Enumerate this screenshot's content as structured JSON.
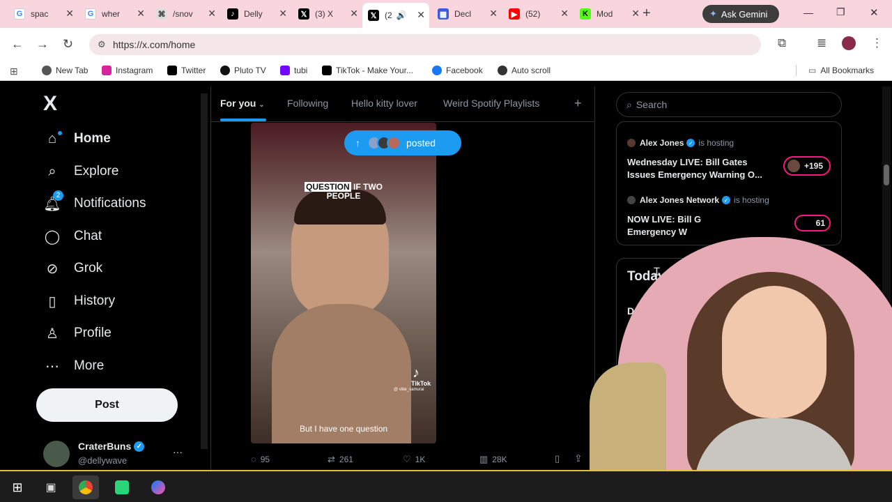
{
  "browser": {
    "tabs": [
      {
        "label": "spac",
        "icon": "google-icon",
        "color": "#4285f4"
      },
      {
        "label": "wher",
        "icon": "google-icon",
        "color": "#4285f4"
      },
      {
        "label": "/snov",
        "icon": "site-icon",
        "color": "#555555"
      },
      {
        "label": "Delly",
        "icon": "tiktok-icon",
        "color": "#000000"
      },
      {
        "label": "(3) X",
        "icon": "x-icon",
        "color": "#000000"
      },
      {
        "label": "(2",
        "icon": "x-icon",
        "color": "#000000"
      },
      {
        "label": "Decl",
        "icon": "calendar-icon",
        "color": "#3b5bdb"
      },
      {
        "label": "(52)",
        "icon": "youtube-icon",
        "color": "#ff0000"
      },
      {
        "label": "Mod",
        "icon": "kick-icon",
        "color": "#53fc18"
      }
    ],
    "new_tab": "+",
    "gemini_label": "Ask Gemini",
    "url": "https://x.com/home",
    "bookmarks": [
      {
        "label": "New Tab",
        "color": "#555555"
      },
      {
        "label": "Instagram",
        "color": "#d6249f"
      },
      {
        "label": "Twitter",
        "color": "#000000"
      },
      {
        "label": "Pluto TV",
        "color": "#111111"
      },
      {
        "label": "tubi",
        "color": "#7408ff"
      },
      {
        "label": "TikTok - Make Your...",
        "color": "#000000"
      },
      {
        "label": "Facebook",
        "color": "#1877f2"
      },
      {
        "label": "Auto scroll",
        "color": "#333333"
      }
    ],
    "all_bookmarks": "All Bookmarks"
  },
  "sidebar": {
    "logo": "X",
    "items": [
      {
        "label": "Home",
        "icon": "home-icon"
      },
      {
        "label": "Explore",
        "icon": "search-icon"
      },
      {
        "label": "Notifications",
        "icon": "bell-icon",
        "badge": "2"
      },
      {
        "label": "Chat",
        "icon": "chat-icon"
      },
      {
        "label": "Grok",
        "icon": "grok-icon"
      },
      {
        "label": "History",
        "icon": "bookmark-icon"
      },
      {
        "label": "Profile",
        "icon": "person-icon"
      },
      {
        "label": "More",
        "icon": "more-icon"
      }
    ],
    "post_button": "Post",
    "account": {
      "name": "CraterBuns",
      "handle": "@dellywave",
      "more": "···"
    }
  },
  "feed": {
    "tabs": [
      "For you",
      "Following",
      "Hello kitty lover",
      "Weird Spotify Playlists"
    ],
    "add_tab": "+",
    "posted_pill": "posted",
    "video": {
      "caption_highlight": "QUESTION",
      "caption_rest_1": "IF TWO",
      "caption_rest_2": "PEOPLE",
      "subtitle": "But I have one question",
      "watermark": "TikTok",
      "watermark_handle": "@ vibe_samurai"
    },
    "stats": {
      "replies": "95",
      "reposts": "261",
      "likes": "1K",
      "views": "28K"
    }
  },
  "right": {
    "search_placeholder": "Search",
    "spaces": [
      {
        "host": "Alex Jones",
        "hosting": "is hosting",
        "title": "Wednesday LIVE: Bill Gates Issues Emergency Warning O...",
        "count": "+195"
      },
      {
        "host": "Alex Jones Network",
        "hosting": "is hosting",
        "title_1": "NOW LIVE: Bill G",
        "title_2": "Emergency W",
        "count": "61"
      }
    ],
    "today_heading": "Today",
    "today_item": "Doll"
  },
  "colors": {
    "accent": "#1d9bf0",
    "tabbar": "#f9d6dd",
    "live_ring": "#f91880"
  }
}
